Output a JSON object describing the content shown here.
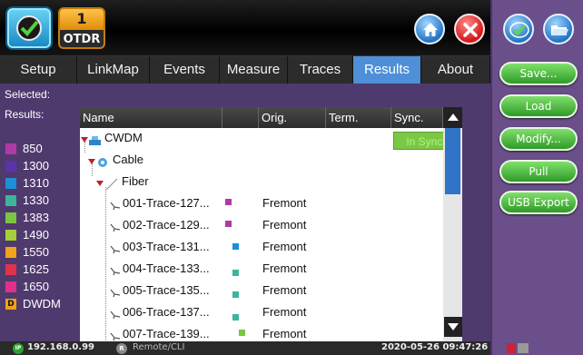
{
  "topbar": {
    "app_icon": "otdr-app-icon",
    "badge_number": "1",
    "badge_label": "OTDR",
    "home_icon": "home-icon",
    "close_icon": "close-icon"
  },
  "tabs": [
    {
      "label": "Setup"
    },
    {
      "label": "LinkMap"
    },
    {
      "label": "Events"
    },
    {
      "label": "Measure"
    },
    {
      "label": "Traces"
    },
    {
      "label": "Results",
      "active": true
    },
    {
      "label": "About"
    }
  ],
  "sidebar": {
    "selected_label": "Selected:",
    "results_label": "Results:",
    "legend": [
      {
        "label": "850",
        "color": "#b03aa5"
      },
      {
        "label": "1300",
        "color": "#5b33a8"
      },
      {
        "label": "1310",
        "color": "#1c8fd8"
      },
      {
        "label": "1330",
        "color": "#3cb59a"
      },
      {
        "label": "1383",
        "color": "#7cc443"
      },
      {
        "label": "1490",
        "color": "#a6cf3b"
      },
      {
        "label": "1550",
        "color": "#f2a21b"
      },
      {
        "label": "1625",
        "color": "#e0324a"
      },
      {
        "label": "1650",
        "color": "#e0308a"
      },
      {
        "label": "DWDM",
        "badge": "D",
        "color": "#f0a018"
      }
    ]
  },
  "table": {
    "columns": {
      "name": "Name",
      "orig": "Orig.",
      "term": "Term.",
      "sync": "Sync."
    },
    "tree": {
      "root": "CWDM",
      "cable": "Cable",
      "fiber": "Fiber",
      "sync_status": "In Sync."
    },
    "rows": [
      {
        "name": "001-Trace-127...",
        "orig": "Fremont",
        "color": "#b03aa5"
      },
      {
        "name": "002-Trace-129...",
        "orig": "Fremont",
        "color": "#b03aa5"
      },
      {
        "name": "003-Trace-131...",
        "orig": "Fremont",
        "color": "#1c8fd8"
      },
      {
        "name": "004-Trace-133...",
        "orig": "Fremont",
        "color": "#3cb59a"
      },
      {
        "name": "005-Trace-135...",
        "orig": "Fremont",
        "color": "#3cb59a"
      },
      {
        "name": "006-Trace-137...",
        "orig": "Fremont",
        "color": "#3cb59a"
      },
      {
        "name": "007-Trace-139...",
        "orig": "Fremont",
        "color": "#7cc443"
      }
    ]
  },
  "right_panel": {
    "buttons": [
      {
        "label": "Save..."
      },
      {
        "label": "Load"
      },
      {
        "label": "Modify..."
      },
      {
        "label": "Pull"
      },
      {
        "label": "USB Export"
      }
    ]
  },
  "status": {
    "ip": "192.168.0.99",
    "remote": "Remote/CLI",
    "datetime": "2020-05-26 09:47:26",
    "ip_badge": "IP",
    "remote_badge": "R"
  }
}
